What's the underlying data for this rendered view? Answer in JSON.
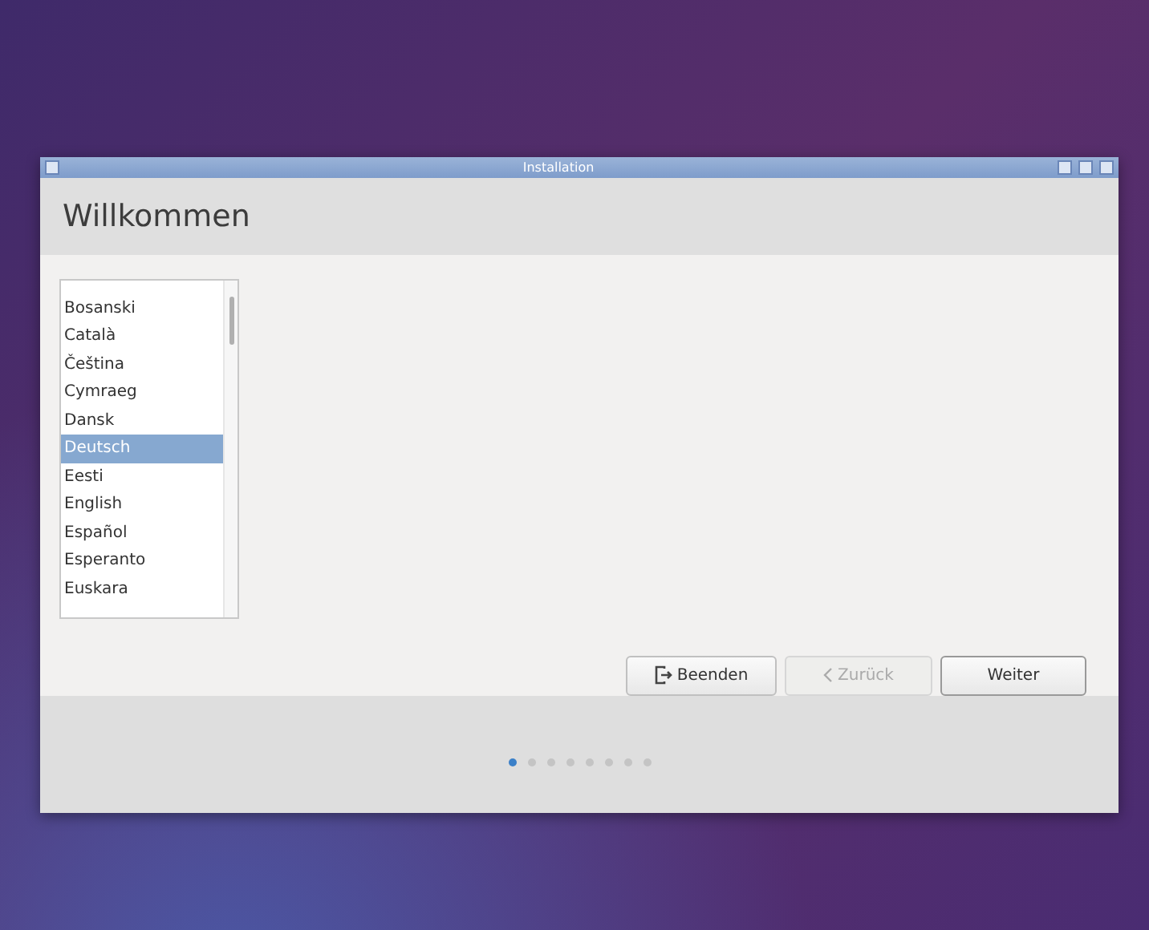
{
  "window": {
    "title": "Installation"
  },
  "header": {
    "title": "Willkommen"
  },
  "languages": [
    {
      "label": "Bosanski",
      "selected": false
    },
    {
      "label": "Català",
      "selected": false
    },
    {
      "label": "Čeština",
      "selected": false
    },
    {
      "label": "Cymraeg",
      "selected": false
    },
    {
      "label": "Dansk",
      "selected": false
    },
    {
      "label": "Deutsch",
      "selected": true
    },
    {
      "label": "Eesti",
      "selected": false
    },
    {
      "label": "English",
      "selected": false
    },
    {
      "label": "Español",
      "selected": false
    },
    {
      "label": "Esperanto",
      "selected": false
    },
    {
      "label": "Euskara",
      "selected": false
    }
  ],
  "buttons": [
    {
      "label": "Beenden",
      "kind": "quit",
      "disabled": false
    },
    {
      "label": "Zurück",
      "kind": "back",
      "disabled": true
    },
    {
      "label": "Weiter",
      "kind": "next",
      "disabled": false
    }
  ],
  "steps": [
    {
      "selected": true
    },
    {
      "selected": false
    },
    {
      "selected": false
    },
    {
      "selected": false
    },
    {
      "selected": false
    },
    {
      "selected": false
    },
    {
      "selected": false
    },
    {
      "selected": false
    }
  ]
}
